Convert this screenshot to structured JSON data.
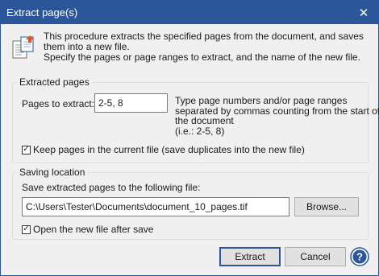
{
  "window": {
    "title": "Extract page(s)",
    "close_glyph": "✕",
    "accent_color": "#2b579a"
  },
  "intro": {
    "icon": "document-extract-icon",
    "line1": "This procedure extracts the specified pages from the document, and saves them into a new file.",
    "line2": "Specify the pages or page ranges to extract, and the name of the new file."
  },
  "extracted_pages": {
    "group_label": "Extracted pages",
    "pages_label": "Pages to extract:",
    "pages_value": "2-5, 8",
    "help_lines": [
      "Type page numbers and/or page ranges",
      "separated by commas counting from the start of",
      "the document",
      "(i.e.: 2-5, 8)"
    ],
    "keep_pages_checked": true,
    "keep_pages_label": "Keep pages in the current file (save duplicates into the new file)"
  },
  "saving_location": {
    "group_label": "Saving location",
    "save_label": "Save extracted pages to the following file:",
    "file_path": "C:\\Users\\Tester\\Documents\\document_10_pages.tif",
    "browse_label": "Browse...",
    "open_after_save_checked": true,
    "open_after_save_label": "Open the new file after save"
  },
  "buttons": {
    "extract_label": "Extract",
    "cancel_label": "Cancel",
    "help_glyph": "?"
  },
  "check_glyph": "✓"
}
